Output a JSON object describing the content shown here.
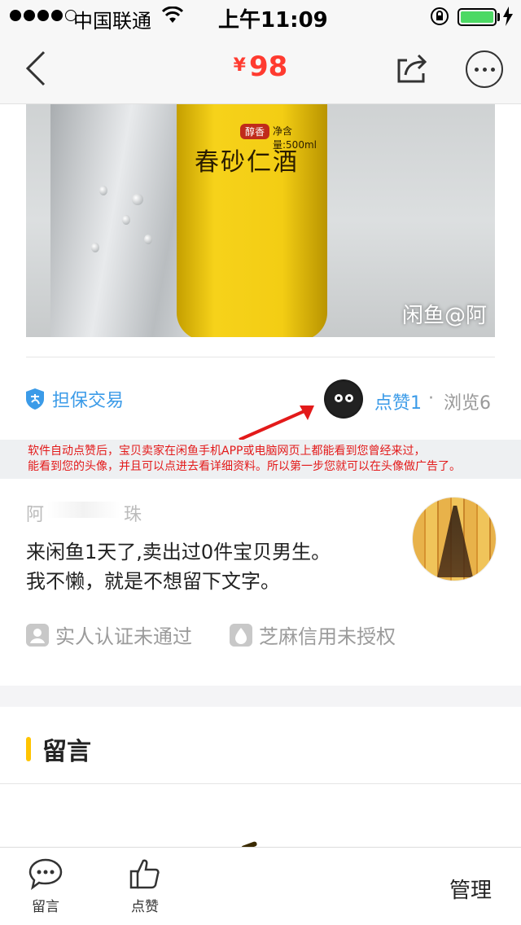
{
  "status_bar": {
    "carrier": "中国联通",
    "time": "上午11:09",
    "battery_level": 1.0
  },
  "nav": {
    "currency_symbol": "¥",
    "price": "98",
    "back_icon": "chevron-left-icon",
    "share_icon": "share-icon",
    "more_icon": "ellipsis-icon"
  },
  "product_image": {
    "label_text": "春砂仁酒",
    "label_tag": "醇香",
    "label_volume": "净含量:500ml",
    "watermark": "闲鱼@阿"
  },
  "trust": {
    "guarantee_label": "担保交易",
    "likes_label": "点赞1",
    "separator": "·",
    "views_label": "浏览6"
  },
  "annotation": {
    "line1": "软件自动点赞后，宝贝卖家在闲鱼手机APP或电脑网页上都能看到您曾经来过，",
    "line2": "能看到您的头像，并且可以点进去看详细资料。所以第一步您就可以在头像做广告了。"
  },
  "seller": {
    "name_visible": "阿　　　　珠",
    "bio_line1": "来闲鱼1天了,卖出过0件宝贝男生。",
    "bio_line2": "我不懒，就是不想留下文字。",
    "badge_realname": "实人认证未通过",
    "badge_credit": "芝麻信用未授权"
  },
  "messages": {
    "title": "留言"
  },
  "bottom_bar": {
    "tab_message": "留言",
    "tab_like": "点赞",
    "manage": "管理"
  },
  "colors": {
    "price": "#ff3b30",
    "link_blue": "#3b9be8",
    "annotation_red": "#e31a1a",
    "section_accent": "#ffc400"
  }
}
